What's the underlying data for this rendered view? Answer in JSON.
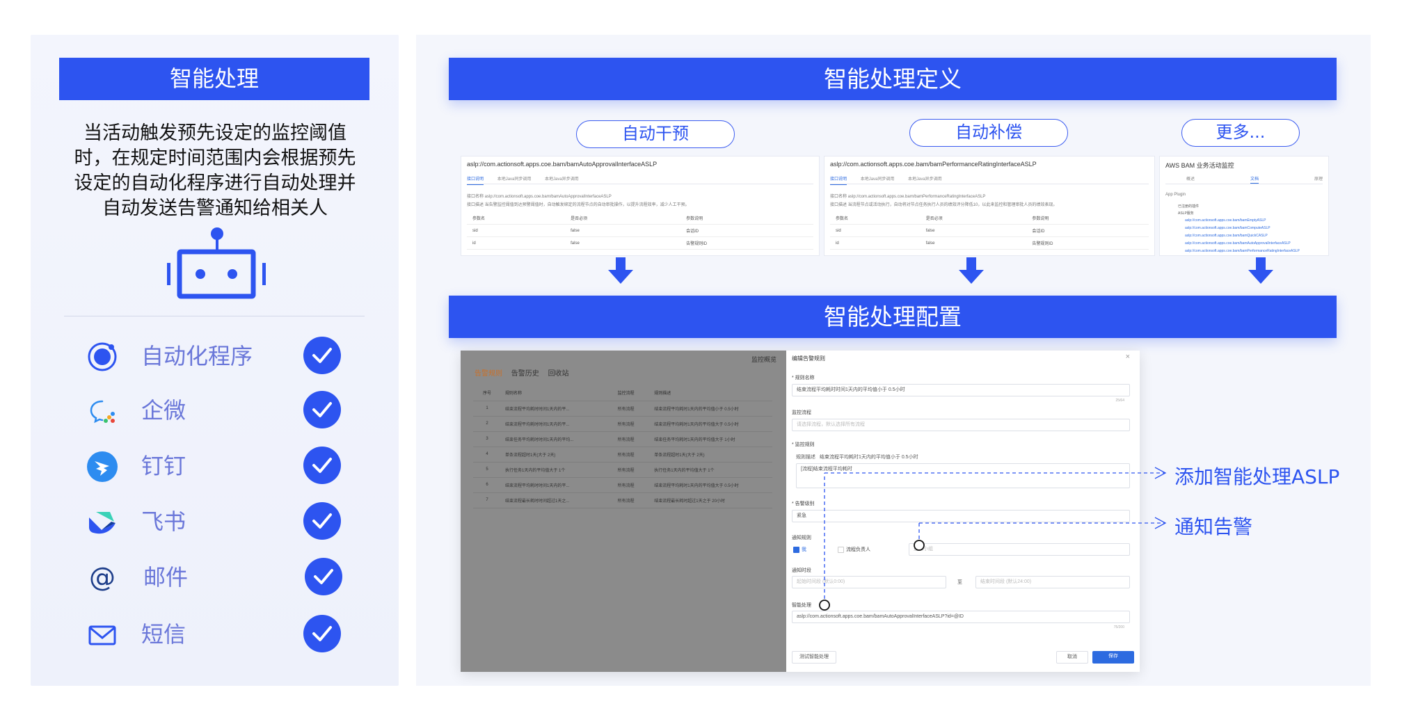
{
  "left": {
    "title": "智能处理",
    "description": "当活动触发预先设定的监控阈值时，在规定时间范围内会根据预先设定的自动化程序进行自动处理并自动发送告警通知给相关人",
    "channels": [
      {
        "label": "自动化程序",
        "icon": "automation-ring-icon"
      },
      {
        "label": "企微",
        "icon": "wecom-icon"
      },
      {
        "label": "钉钉",
        "icon": "dingtalk-icon"
      },
      {
        "label": "飞书",
        "icon": "feishu-icon"
      },
      {
        "label": "邮件",
        "icon": "at-mail-icon"
      },
      {
        "label": "短信",
        "icon": "envelope-icon"
      }
    ]
  },
  "definition": {
    "title": "智能处理定义",
    "categories": [
      "自动干预",
      "自动补偿",
      "更多..."
    ],
    "cards": [
      {
        "header": "aslp://com.actionsoft.apps.coe.bam/bamAutoApprovalInterfaceASLP",
        "tabs": [
          "接口说明",
          "本地Java同步调用",
          "本地Java异步调用"
        ],
        "line1": "接口名称  aslp://com.actionsoft.apps.coe.bam/bamAutoApprovalInterfaceASLP",
        "line2": "接口描述  当告警监控阈值到达预警阈值时，自动触发绑定的流程节点的自动审批操作，以提升流程效率，减少人工干预。",
        "rows": [
          [
            "参数名",
            "是否必须",
            "参数说明"
          ],
          [
            "sid",
            "false",
            "会话ID"
          ],
          [
            "id",
            "false",
            "告警规则ID"
          ]
        ]
      },
      {
        "header": "aslp://com.actionsoft.apps.coe.bam/bamPerformanceRatingInterfaceASLP",
        "tabs": [
          "接口说明",
          "本地Java同步调用",
          "本地Java异步调用"
        ],
        "line1": "接口名称  aslp://com.actionsoft.apps.coe.bam/bamPerformanceRatingInterfaceASLP",
        "line2": "接口描述  当流程节点或活动执行，自动将对节点任务执行人员的绩效评分降低10，以此来监控和管理审批人员的绩效表现。",
        "rows": [
          [
            "参数名",
            "是否必须",
            "参数说明"
          ],
          [
            "sid",
            "false",
            "会话ID"
          ],
          [
            "id",
            "false",
            "告警规则ID"
          ]
        ]
      },
      {
        "header": "AWS BAM 业务活动监控",
        "tabs": [
          "概述",
          "文档",
          "原理"
        ],
        "plugin_title": "App Plugin",
        "plugin_items": [
          "已注册的插件",
          "ASLP服务",
          "aslp://com.actionsoft.apps.coe.bam/bamEmptyASLP",
          "aslp://com.actionsoft.apps.coe.bam/bamComputeASLP",
          "aslp://com.actionsoft.apps.coe.bam/bamQuickCASLP",
          "aslp://com.actionsoft.apps.coe.bam/bamAutoApprovalInterfaceASLP",
          "aslp://com.actionsoft.apps.coe.bam/bamPerformanceRatingInterfaceASLP"
        ]
      }
    ]
  },
  "config": {
    "title": "智能处理配置",
    "overview": "监控概览",
    "tabs": [
      "告警规则",
      "告警历史",
      "回收站"
    ],
    "table": {
      "headers": [
        "序号",
        "规则名称",
        "监控流程",
        "规则描述"
      ],
      "rows": [
        [
          "1",
          "结束流程平均耗时时间1天内的平...",
          "所有流程",
          "结束流程平均耗时1天内的平均值小于 0.5小时"
        ],
        [
          "2",
          "结束流程平均耗时时间1天内的平...",
          "所有流程",
          "结束流程平均耗时1天内的平均值大于 0.5小时"
        ],
        [
          "3",
          "结束任务平均耗时时间1天内的平均...",
          "所有流程",
          "结束任务平均耗时1天内的平均值大于 1小时"
        ],
        [
          "4",
          "单条流程超时1天(大于 2天)",
          "所有流程",
          "单条流程超时1天(大于 2天)"
        ],
        [
          "5",
          "执行任务1天内的平均值大于 1个",
          "所有流程",
          "执行任务1天内的平均值大于 1个"
        ],
        [
          "6",
          "结束流程平均耗时时间1天内的平...",
          "所有流程",
          "结束流程平均耗时1天内的平均值大于 0.5小时"
        ],
        [
          "7",
          "结束流程最长耗时时间超过1天之...",
          "所有流程",
          "结束流程最长耗时超过1天之于 20小时"
        ]
      ]
    },
    "drawer": {
      "title": "编辑告警规则",
      "close": "×",
      "name_label": "* 规则名称",
      "name_value": "结束流程平均耗时时间1天内的平均值小于 0.5小时",
      "name_count": "25/64",
      "process_label": "监控流程",
      "process_placeholder": "请选择流程，默认选择所有流程",
      "rule_label": "* 监控规则",
      "rule_desc_label": "规则描述",
      "rule_desc_value": "结束流程平均耗时1天内的平均值小于 0.5小时",
      "rule_value": "[流程]结束流程平均耗时",
      "level_label": "* 告警级别",
      "level_value": "紧急",
      "notify_label": "通知规则",
      "notify_opt1": "我",
      "notify_opt2": "流程负责人",
      "notify_group_placeholder": "通知小组",
      "time_label": "通知时段",
      "time_start": "起始时间段 (默认0:00)",
      "time_sep": "至",
      "time_end": "结束时间段 (默认24:00)",
      "smart_label": "智能处理",
      "smart_value": "aslp://com.actionsoft.apps.coe.bam/bamAutoApprovalInterfaceASLP?id=@ID",
      "smart_count": "75/200",
      "test_button": "测试智能处理",
      "cancel_button": "取消",
      "save_button": "保存"
    },
    "callouts": [
      "添加智能处理ASLP",
      "通知告警"
    ]
  },
  "colors": {
    "accent": "#2d54f0",
    "text_blue": "#6a77d9"
  }
}
